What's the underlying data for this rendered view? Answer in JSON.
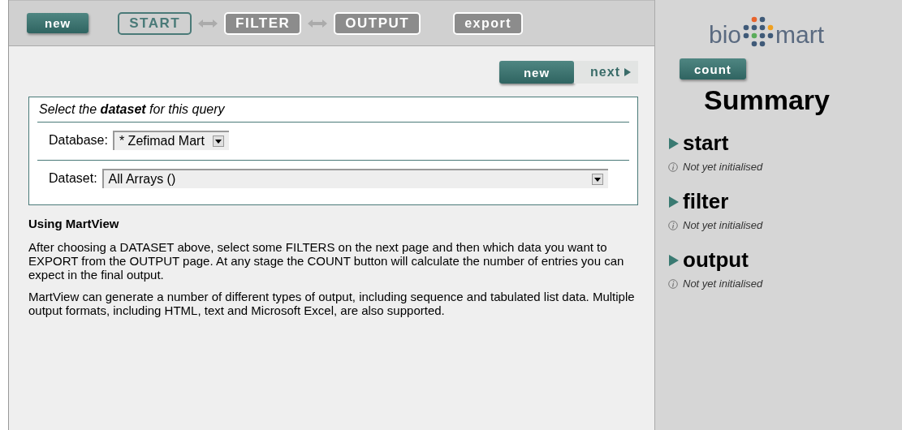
{
  "toolbar": {
    "new_button": "new",
    "steps": [
      {
        "label": "START",
        "selected": true
      },
      {
        "label": "FILTER",
        "selected": false
      },
      {
        "label": "OUTPUT",
        "selected": false
      }
    ],
    "export_button": {
      "label": "export",
      "disabled": true
    }
  },
  "nav": {
    "new_button": "new",
    "next_button": "next"
  },
  "dataset_box": {
    "intro": "Select the **dataset** for this query",
    "fields": [
      {
        "label": "Database:",
        "value": "* Zefimad Mart",
        "wide": false
      },
      {
        "label": "Dataset:",
        "value": "All Arrays ()",
        "wide": true
      }
    ]
  },
  "help": {
    "heading": "Using MartView",
    "paragraphs": [
      "After choosing a DATASET above, select some FILTERS on the next page and then which data you want to EXPORT from the OUTPUT page. At any stage the COUNT button will calculate the number of entries you can expect in the final output.",
      "MartView can generate a number of different types of output, including sequence and tabulated list data. Multiple output formats, including HTML, text and Microsoft Excel, are also supported."
    ]
  },
  "sidebar": {
    "logo": {
      "left": "bio",
      "right": "mart"
    },
    "count_button": "count",
    "title": "Summary",
    "sections": [
      {
        "name": "start",
        "status": "Not yet initialised"
      },
      {
        "name": "filter",
        "status": "Not yet initialised"
      },
      {
        "name": "output",
        "status": "Not yet initialised"
      }
    ]
  }
}
